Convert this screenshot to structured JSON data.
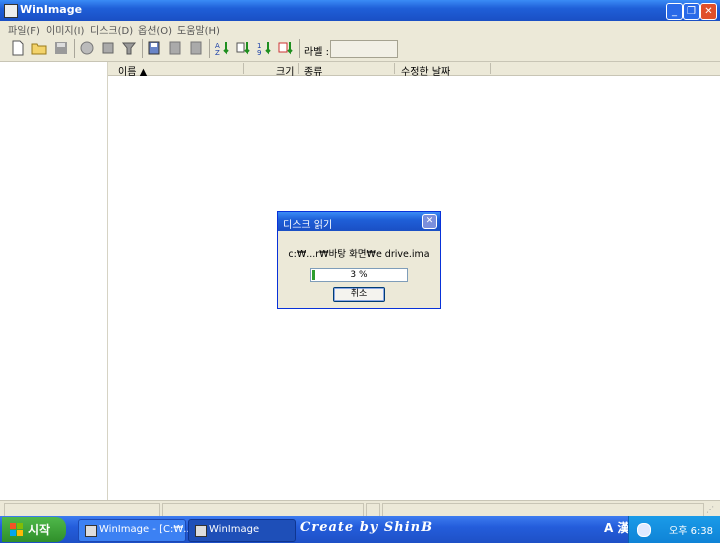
{
  "window": {
    "title": "WinImage"
  },
  "menu": [
    {
      "label": "파일(F)"
    },
    {
      "label": "이미지(I)"
    },
    {
      "label": "디스크(D)"
    },
    {
      "label": "옵션(O)"
    },
    {
      "label": "도움말(H)"
    }
  ],
  "toolbar": {
    "label_caption": "라벨 :",
    "label_value": "",
    "icons": [
      "new-file-icon",
      "open-folder-icon",
      "save-icon",
      "inject-icon",
      "extract-icon",
      "delete-icon",
      "read-disk-icon",
      "write-disk-icon",
      "format-disk-icon",
      "sort-name-icon",
      "sort-type-icon",
      "sort-size-icon",
      "sort-date-icon"
    ]
  },
  "list": {
    "columns": [
      {
        "label": "이름 ▲"
      },
      {
        "label": "크기"
      },
      {
        "label": "종류"
      },
      {
        "label": "수정한 날짜"
      }
    ]
  },
  "dialog": {
    "title": "디스크 읽기",
    "path": "c:₩...r₩바탕 화면₩e drive.ima",
    "progress_text": "3 %",
    "progress": 0.03,
    "cancel_label": "취소"
  },
  "taskbar": {
    "start_label": "시작",
    "tasks": [
      {
        "label": "WinImage - [C:₩..."
      },
      {
        "label": "WinImage"
      }
    ],
    "brand": "Create by ShinB",
    "ime": "A 漢",
    "clock": "오후 6:38"
  },
  "colors": {
    "title_blue": "#1f5fd8",
    "chrome": "#ece9d8",
    "start_green": "#3aa535",
    "tray_blue": "#1193e0",
    "progress_green": "#2d9d2d"
  }
}
